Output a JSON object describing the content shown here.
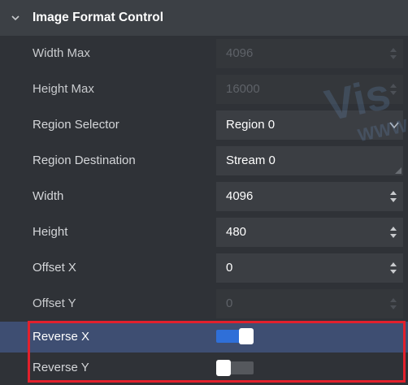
{
  "section": {
    "title": "Image Format Control"
  },
  "properties": [
    {
      "label": "Width Max",
      "value": "4096",
      "control": "spin",
      "disabled": true
    },
    {
      "label": "Height Max",
      "value": "16000",
      "control": "spin",
      "disabled": true
    },
    {
      "label": "Region Selector",
      "value": "Region 0",
      "control": "dropdown",
      "disabled": false
    },
    {
      "label": "Region Destination",
      "value": "Stream 0",
      "control": "text",
      "disabled": false
    },
    {
      "label": "Width",
      "value": "4096",
      "control": "spin",
      "disabled": false
    },
    {
      "label": "Height",
      "value": "480",
      "control": "spin",
      "disabled": false
    },
    {
      "label": "Offset X",
      "value": "0",
      "control": "spin",
      "disabled": false
    },
    {
      "label": "Offset Y",
      "value": "0",
      "control": "spin",
      "disabled": true
    }
  ],
  "toggles": [
    {
      "label": "Reverse X",
      "on": true,
      "selected": true
    },
    {
      "label": "Reverse Y",
      "on": false,
      "selected": false
    }
  ],
  "watermark": {
    "text1": "Vis",
    "text2": "WWW"
  },
  "colors": {
    "panel_bg": "#2f3237",
    "header_bg": "#3c4045",
    "field_bg": "#3b3e43",
    "selected_row": "#3e4e72",
    "toggle_on": "#2f6fd8",
    "toggle_off": "#55585d",
    "highlight": "#e2202c"
  }
}
